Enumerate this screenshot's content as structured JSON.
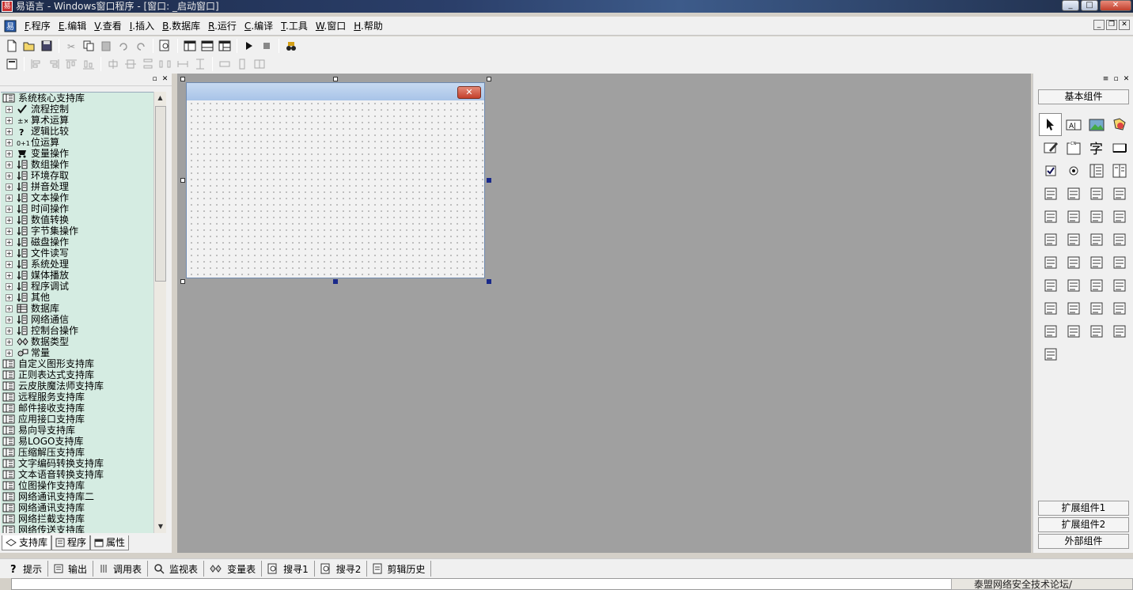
{
  "window": {
    "title": "易语言 - Windows窗口程序 - [窗口: _启动窗口]",
    "minimize": "_",
    "maximize": "□",
    "close": "✕"
  },
  "menu": [
    {
      "key": "F",
      "label": ".程序"
    },
    {
      "key": "E",
      "label": ".编辑"
    },
    {
      "key": "V",
      "label": ".查看"
    },
    {
      "key": "I",
      "label": ".插入"
    },
    {
      "key": "B",
      "label": ".数据库"
    },
    {
      "key": "R",
      "label": ".运行"
    },
    {
      "key": "C",
      "label": ".编译"
    },
    {
      "key": "T",
      "label": ".工具"
    },
    {
      "key": "W",
      "label": ".窗口"
    },
    {
      "key": "H",
      "label": ".帮助"
    }
  ],
  "left_panel": {
    "tree": [
      {
        "label": "系统核心支持库",
        "level": 0
      },
      {
        "label": "流程控制",
        "level": 1,
        "icon": "check"
      },
      {
        "label": "算术运算",
        "level": 1,
        "icon": "math"
      },
      {
        "label": "逻辑比较",
        "level": 1,
        "icon": "question"
      },
      {
        "label": "位运算",
        "level": 1,
        "icon": "bits"
      },
      {
        "label": "变量操作",
        "level": 1,
        "icon": "var"
      },
      {
        "label": "数组操作",
        "level": 1,
        "icon": "doc"
      },
      {
        "label": "环境存取",
        "level": 1,
        "icon": "doc"
      },
      {
        "label": "拼音处理",
        "level": 1,
        "icon": "doc"
      },
      {
        "label": "文本操作",
        "level": 1,
        "icon": "doc"
      },
      {
        "label": "时间操作",
        "level": 1,
        "icon": "doc"
      },
      {
        "label": "数值转换",
        "level": 1,
        "icon": "doc"
      },
      {
        "label": "字节集操作",
        "level": 1,
        "icon": "doc"
      },
      {
        "label": "磁盘操作",
        "level": 1,
        "icon": "doc"
      },
      {
        "label": "文件读写",
        "level": 1,
        "icon": "doc"
      },
      {
        "label": "系统处理",
        "level": 1,
        "icon": "doc"
      },
      {
        "label": "媒体播放",
        "level": 1,
        "icon": "doc"
      },
      {
        "label": "程序调试",
        "level": 1,
        "icon": "doc"
      },
      {
        "label": "其他",
        "level": 1,
        "icon": "doc"
      },
      {
        "label": "数据库",
        "level": 1,
        "icon": "grid"
      },
      {
        "label": "网络通信",
        "level": 1,
        "icon": "doc"
      },
      {
        "label": "控制台操作",
        "level": 1,
        "icon": "doc"
      },
      {
        "label": "数据类型",
        "level": 1,
        "icon": "types"
      },
      {
        "label": "常量",
        "level": 1,
        "icon": "const"
      },
      {
        "label": "自定义图形支持库",
        "level": 0
      },
      {
        "label": "正则表达式支持库",
        "level": 0
      },
      {
        "label": "云皮肤魔法师支持库",
        "level": 0
      },
      {
        "label": "远程服务支持库",
        "level": 0
      },
      {
        "label": "邮件接收支持库",
        "level": 0
      },
      {
        "label": "应用接口支持库",
        "level": 0
      },
      {
        "label": "易向导支持库",
        "level": 0
      },
      {
        "label": "易LOGO支持库",
        "level": 0
      },
      {
        "label": "压缩解压支持库",
        "level": 0
      },
      {
        "label": "文字编码转换支持库",
        "level": 0
      },
      {
        "label": "文本语音转换支持库",
        "level": 0
      },
      {
        "label": "位图操作支持库",
        "level": 0
      },
      {
        "label": "网络通讯支持库二",
        "level": 0
      },
      {
        "label": "网络通讯支持库",
        "level": 0
      },
      {
        "label": "网络拦截支持库",
        "level": 0
      },
      {
        "label": "网络传送支持库",
        "level": 0
      }
    ],
    "tabs": [
      "支持库",
      "程序",
      "属性"
    ]
  },
  "right_panel": {
    "header": "基本组件",
    "extended1": "扩展组件1",
    "extended2": "扩展组件2",
    "external": "外部组件",
    "palette": [
      "pointer-icon",
      "label-icon",
      "picture-box-icon",
      "shape-icon",
      "edit-box-icon",
      "group-box-icon",
      "text-icon",
      "button-icon",
      "checkbox-icon",
      "radio-icon",
      "combo-box-icon",
      "list-box-icon",
      "select-list-icon",
      "hscroll-icon",
      "vscroll-icon",
      "progress-icon",
      "slider-icon",
      "tab-icon",
      "video-icon",
      "animation-icon",
      "calendar-icon",
      "drive-box-icon",
      "dir-box-icon",
      "file-box-icon",
      "color-picker-icon",
      "hyperlink-icon",
      "adjuster-icon",
      "transparent-label-icon",
      "timer-icon",
      "printer-icon",
      "data-source-icon",
      "data-provider-icon",
      "client-icon",
      "server-icon",
      "serial-port-icon",
      "table-icon",
      "outline-icon",
      "database-provider-icon",
      "chart-icon",
      "odbc-database-icon",
      "odbc-provider-icon"
    ]
  },
  "bottom_tabs": [
    "提示",
    "输出",
    "调用表",
    "监视表",
    "变量表",
    "搜寻1",
    "搜寻2",
    "剪辑历史"
  ],
  "notice": "泰盟网络安全技术论坛/"
}
